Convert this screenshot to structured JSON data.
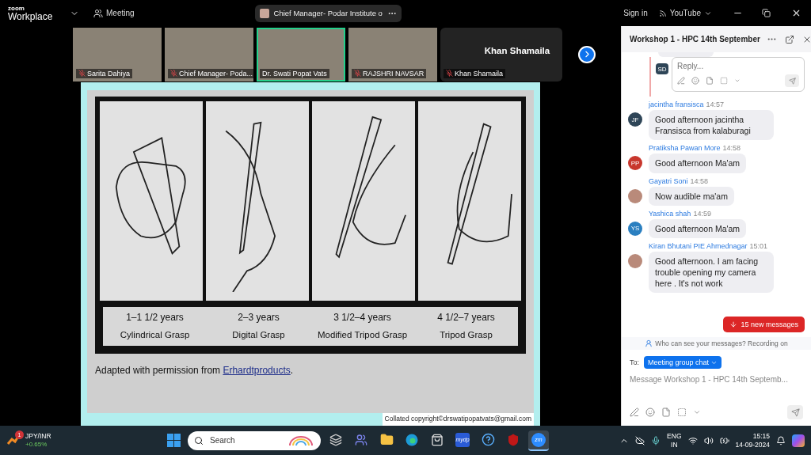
{
  "app_bar": {
    "logo_top": "zoom",
    "logo_bottom": "Workplace",
    "meeting_label": "Meeting",
    "speaker_pill": "Chief Manager- Podar Institute o",
    "sign_in": "Sign in",
    "stream": "YouTube"
  },
  "video_strip": {
    "tiles": [
      {
        "kind": "video",
        "name": "Sarita Dahiya",
        "muted": true,
        "speaking": false
      },
      {
        "kind": "video",
        "name": "Chief Manager- Poda...",
        "muted": true,
        "speaking": false
      },
      {
        "kind": "video",
        "name": "Dr. Swati Popat Vats",
        "muted": false,
        "speaking": true
      },
      {
        "kind": "video",
        "name": "RAJSHRI NAVSAR",
        "muted": true,
        "speaking": false
      },
      {
        "kind": "name",
        "name": "Khan Shamaila",
        "display": "Khan Shamaila",
        "muted": true,
        "speaking": false
      }
    ]
  },
  "slide": {
    "panels": [
      {
        "age": "1–1 1/2 years",
        "grasp": "Cylindrical Grasp"
      },
      {
        "age": "2–3 years",
        "grasp": "Digital Grasp"
      },
      {
        "age": "3 1/2–4 years",
        "grasp": "Modified Tripod Grasp"
      },
      {
        "age": "4 1/2–7 years",
        "grasp": "Tripod Grasp"
      }
    ],
    "caption": {
      "before": "Adapted with permission from ",
      "link": "Erhardtproducts",
      "after": "."
    },
    "copyright": "Collated copyright©drswatipopatvats@gmail.com"
  },
  "chat": {
    "title": "Workshop 1 - HPC 14th September",
    "reply": {
      "initials": "SD",
      "placeholder": "Reply..."
    },
    "messages": [
      {
        "sender": "jacintha fransisca",
        "time": "14:57",
        "avatar": {
          "kind": "initials",
          "initials": "JF",
          "color": "#2e4557"
        },
        "text": "Good afternoon jacintha Fransisca from kalaburagi"
      },
      {
        "sender": "Pratiksha Pawan More",
        "time": "14:58",
        "avatar": {
          "kind": "initials",
          "initials": "PP",
          "color": "#c8372d"
        },
        "text": "Good afternoon Ma'am"
      },
      {
        "sender": "Gayatri Soni",
        "time": "14:58",
        "avatar": {
          "kind": "photo"
        },
        "text": "Now audible ma'am"
      },
      {
        "sender": "Yashica shah",
        "time": "14:59",
        "avatar": {
          "kind": "initials",
          "initials": "YS",
          "color": "#2a7fc0"
        },
        "text": "Good afternoon Ma'am"
      },
      {
        "sender": "Kiran Bhutani PIE Ahmednagar",
        "time": "15:01",
        "avatar": {
          "kind": "photo"
        },
        "text": "Good afternoon. I am facing trouble opening my camera here . It's not work"
      }
    ],
    "new_messages": "15 new messages",
    "privacy": "Who can see your messages? Recording on",
    "to_label": "To:",
    "recipient": "Meeting group chat",
    "placeholder": "Message Workshop 1 - HPC 14th Septemb..."
  },
  "taskbar": {
    "widget": {
      "badge": "1",
      "symbol": "JPY/INR",
      "change": "+0.65%"
    },
    "search": {
      "placeholder": "Search"
    },
    "apps": [
      {
        "kind": "taskview",
        "selected": false
      },
      {
        "kind": "teams",
        "selected": false
      },
      {
        "kind": "folder",
        "selected": false
      },
      {
        "kind": "browser",
        "selected": false
      },
      {
        "kind": "store",
        "selected": false
      },
      {
        "kind": "text",
        "label": "mydp",
        "selected": false
      },
      {
        "kind": "help",
        "selected": false
      },
      {
        "kind": "shield",
        "selected": false
      },
      {
        "kind": "zoom",
        "label": "zm",
        "selected": true
      }
    ],
    "lang": "ENG",
    "region": "IN",
    "time": "15:15",
    "date": "14-09-2024"
  }
}
